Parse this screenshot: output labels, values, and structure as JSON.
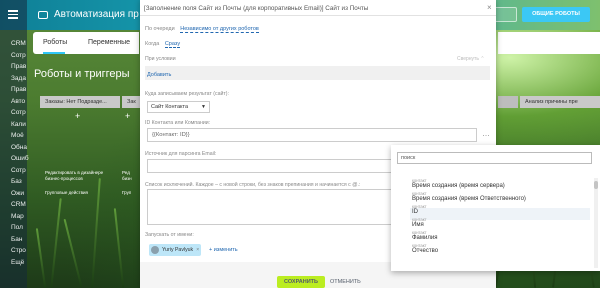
{
  "app": {
    "title": "Автоматизация пр"
  },
  "header": {
    "robots_button": "ОБЩИЕ РОБОТЫ"
  },
  "left_nav": [
    "CRM",
    "Сотр",
    "Прав",
    "Зада",
    "Прав",
    "Авто",
    "Сотр",
    "Кали",
    "Моё",
    "Обна",
    "Ошиб",
    "Сотр",
    "Баз",
    "Ожи",
    "CRM",
    "Мар",
    "Пол",
    "Бан",
    "Стро",
    "Ещё"
  ],
  "tabs": {
    "robots": "Роботы",
    "variables": "Переменные"
  },
  "section": {
    "title": "Роботы и триггеры"
  },
  "stages": {
    "first": "Заказы: Нет Подразде...",
    "second": "Зак",
    "right": "Анализ причины пре"
  },
  "robot_cards": [
    {
      "line1": "Редактировать в дизайнере",
      "line2": "бизнес-процессов"
    },
    {
      "line1": "Групповые действия",
      "line2": ""
    },
    {
      "line1": "Ред",
      "line2": "бизн"
    },
    {
      "line1": "Груп",
      "line2": ""
    }
  ],
  "modal": {
    "title": "[Заполнение поля Сайт из Почты (для корпоративных Email)] Сайт из Почты",
    "queue_label": "По очереди",
    "queue_value": "Независимо от других роботов",
    "when_label": "Когда",
    "when_value": "Сразу",
    "condition_label": "При условии",
    "collapse_label": "Свернуть ⌃",
    "add_label": "Добавить",
    "result_label": "Куда записываем результат (сайт):",
    "result_value": "Сайт Контакта",
    "id_label": "ID Контакта или Компании:",
    "id_value": "{{Контакт: ID}}",
    "email_label": "Источник для парсинга Email:",
    "exclusions_label": "Список исключений. Каждое – с новой строки, без знаков препинания и начинается с @.:",
    "run_as_label": "Запускать от имени:",
    "user_name": "Yuriy Pavlyuk",
    "change_label": "+ изменить",
    "save": "СОХРАНИТЬ",
    "cancel": "ОТМЕНИТЬ"
  },
  "popup": {
    "search_value": "поиск",
    "options": [
      {
        "category": "контакт",
        "name": "Время создания (время сервера)"
      },
      {
        "category": "контакт",
        "name": "Время создания (время Ответственного)"
      },
      {
        "category": "контакт",
        "name": "ID"
      },
      {
        "category": "контакт",
        "name": "Имя"
      },
      {
        "category": "контакт",
        "name": "Фамилия"
      },
      {
        "category": "контакт",
        "name": "Отчество"
      }
    ]
  }
}
